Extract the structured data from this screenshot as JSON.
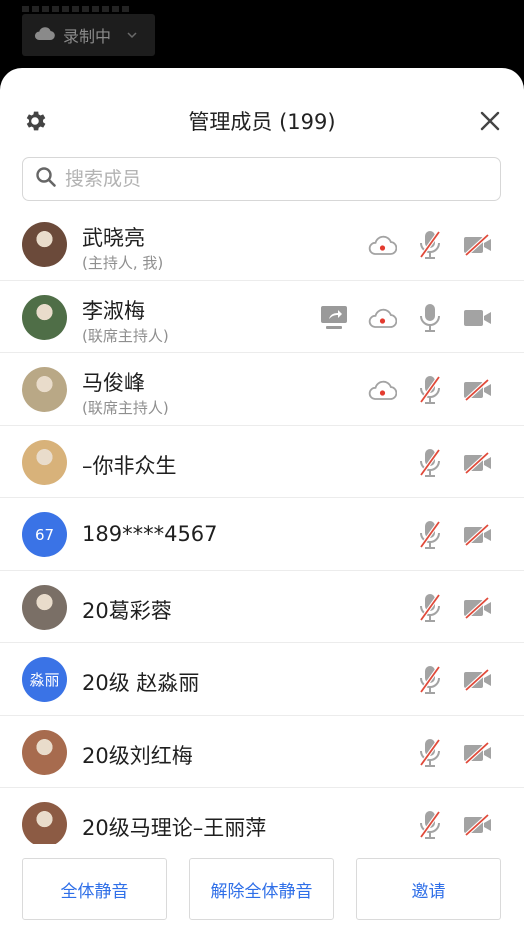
{
  "recording": {
    "label": "录制中"
  },
  "panel": {
    "title": "管理成员 (199)"
  },
  "search": {
    "placeholder": "搜索成员"
  },
  "members": [
    {
      "name": "武晓亮",
      "role": "(主持人, 我)",
      "share": false,
      "record": true,
      "mic_muted": true,
      "cam_off": true,
      "avatar": "photo",
      "avatar_color": "#6b4a3a"
    },
    {
      "name": "李淑梅",
      "role": "(联席主持人)",
      "share": true,
      "record": true,
      "mic_muted": false,
      "cam_off": false,
      "avatar": "photo",
      "avatar_color": "#4f6e47"
    },
    {
      "name": "马俊峰",
      "role": "(联席主持人)",
      "share": false,
      "record": true,
      "mic_muted": true,
      "cam_off": true,
      "avatar": "photo",
      "avatar_color": "#b9a886"
    },
    {
      "name": "–你非众生",
      "role": "",
      "share": false,
      "record": false,
      "mic_muted": true,
      "cam_off": true,
      "avatar": "photo",
      "avatar_color": "#d8b27a"
    },
    {
      "name": "189****4567",
      "role": "",
      "share": false,
      "record": false,
      "mic_muted": true,
      "cam_off": true,
      "avatar": "text",
      "avatar_text": "67"
    },
    {
      "name": "20葛彩蓉",
      "role": "",
      "share": false,
      "record": false,
      "mic_muted": true,
      "cam_off": true,
      "avatar": "photo",
      "avatar_color": "#7a6f66"
    },
    {
      "name": "20级 赵淼丽",
      "role": "",
      "share": false,
      "record": false,
      "mic_muted": true,
      "cam_off": true,
      "avatar": "text",
      "avatar_text": "淼丽"
    },
    {
      "name": "20级刘红梅",
      "role": "",
      "share": false,
      "record": false,
      "mic_muted": true,
      "cam_off": true,
      "avatar": "photo",
      "avatar_color": "#a76b4e"
    },
    {
      "name": "20级马理论–王丽萍",
      "role": "",
      "share": false,
      "record": false,
      "mic_muted": true,
      "cam_off": true,
      "avatar": "photo",
      "avatar_color": "#8c5b44"
    }
  ],
  "footer": {
    "mute_all": "全体静音",
    "unmute_all": "解除全体静音",
    "invite": "邀请"
  },
  "colors": {
    "accent": "#2f6fe8",
    "muted_red": "#e04a3a",
    "record_red": "#e33b2f",
    "icon_gray": "#a3a3a3"
  }
}
